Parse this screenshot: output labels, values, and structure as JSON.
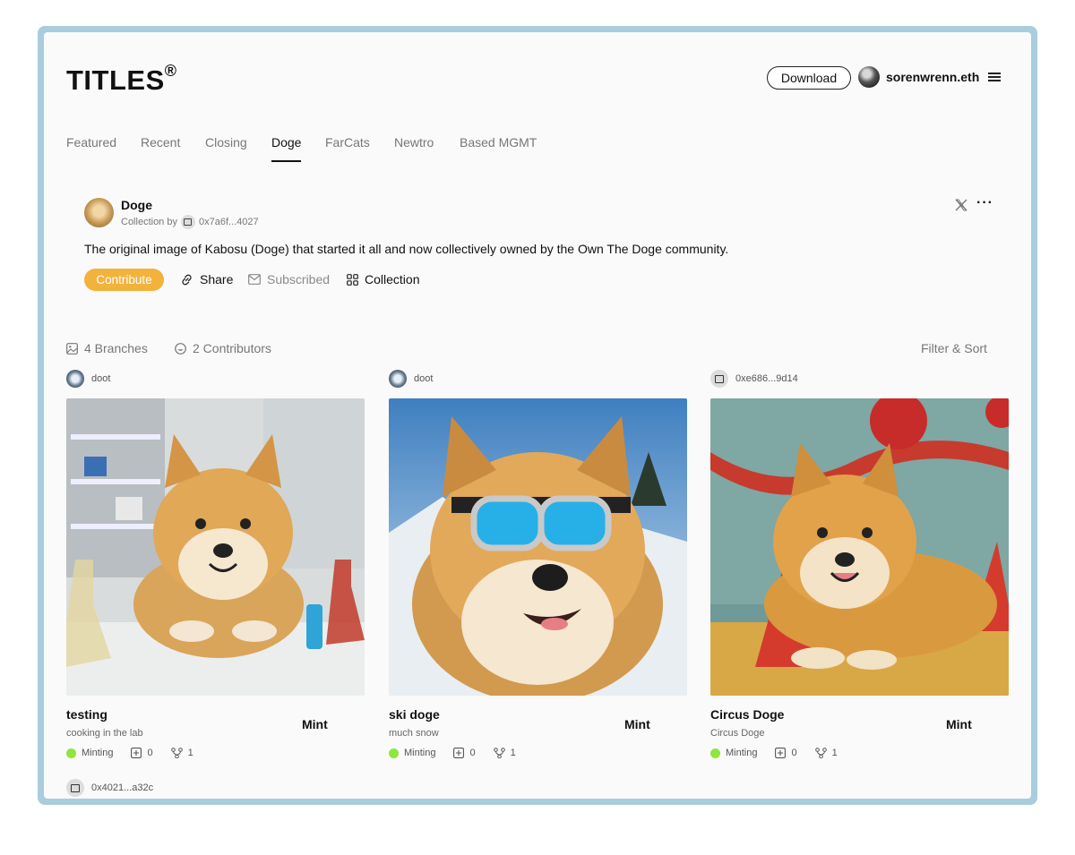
{
  "header": {
    "logo": "TITLES",
    "logo_mark": "®",
    "download_label": "Download",
    "username": "sorenwrenn.eth"
  },
  "tabs": [
    {
      "label": "Featured",
      "active": false
    },
    {
      "label": "Recent",
      "active": false
    },
    {
      "label": "Closing",
      "active": false
    },
    {
      "label": "Doge",
      "active": true
    },
    {
      "label": "FarCats",
      "active": false
    },
    {
      "label": "Newtro",
      "active": false
    },
    {
      "label": "Based MGMT",
      "active": false
    }
  ],
  "collection": {
    "name": "Doge",
    "by_label": "Collection by",
    "owner_address": "0x7a6f...4027",
    "description": "The original image of Kabosu (Doge) that started it all and now collectively owned by the Own The Doge community.",
    "actions": {
      "contribute": "Contribute",
      "share": "Share",
      "subscribed": "Subscribed",
      "collection": "Collection"
    }
  },
  "stats": {
    "branches": "4 Branches",
    "contributors": "2 Contributors",
    "filter_sort": "Filter & Sort"
  },
  "cards": [
    {
      "author": "doot",
      "author_type": "avatar",
      "title": "testing",
      "subtitle": "cooking in the lab",
      "mint": "Mint",
      "status": "Minting",
      "contributions": "0",
      "branches": "1",
      "image": "shiba-in-lab"
    },
    {
      "author": "doot",
      "author_type": "avatar",
      "title": "ski doge",
      "subtitle": "much snow",
      "mint": "Mint",
      "status": "Minting",
      "contributions": "0",
      "branches": "1",
      "image": "shiba-with-ski-goggles"
    },
    {
      "author": "0xe686...9d14",
      "author_type": "wallet",
      "title": "Circus Doge",
      "subtitle": "Circus Doge",
      "mint": "Mint",
      "status": "Minting",
      "contributions": "0",
      "branches": "1",
      "image": "shiba-at-circus"
    }
  ],
  "next_card_author": "0x4021...a32c",
  "colors": {
    "frame": "#a9cddd",
    "accent_contribute": "#f2b33d",
    "status_minting": "#8ee63e"
  }
}
